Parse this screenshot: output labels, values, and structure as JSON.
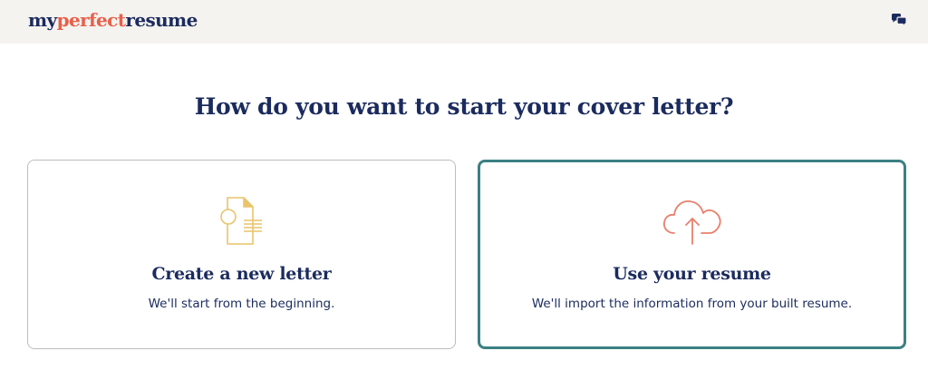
{
  "header": {
    "logo_part1": "my",
    "logo_part2": "perfect",
    "logo_part3": "resume",
    "chat_icon": "chat-bubbles-icon"
  },
  "main": {
    "title": "How do you want to start your cover letter?",
    "options": [
      {
        "title": "Create a new letter",
        "description": "We'll start from the beginning.",
        "icon": "new-document-icon",
        "selected": false
      },
      {
        "title": "Use your resume",
        "description": "We'll import the information from your built resume.",
        "icon": "cloud-upload-icon",
        "selected": true
      }
    ]
  },
  "colors": {
    "navy": "#1b2b5e",
    "coral": "#e8604c",
    "header_bg": "#f5f3ef",
    "selected_border": "#3b8083",
    "doc_icon": "#e9c46a"
  }
}
